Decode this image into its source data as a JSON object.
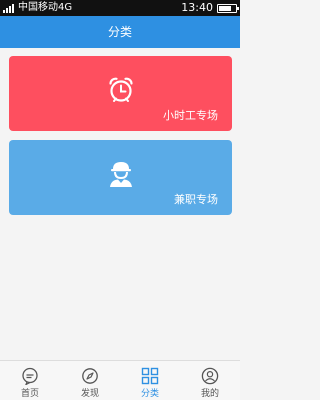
{
  "status_bar": {
    "carrier": "中国移动4G",
    "time": "13:40",
    "battery_level": 0.75
  },
  "header": {
    "title": "分类"
  },
  "cards": [
    {
      "label": "小时工专场",
      "icon": "alarm-clock-icon",
      "color": "#fe4f5f"
    },
    {
      "label": "兼职专场",
      "icon": "worker-cap-icon",
      "color": "#5aabe7"
    }
  ],
  "tabs": [
    {
      "label": "首页",
      "icon": "home-chat-icon",
      "active": false
    },
    {
      "label": "发现",
      "icon": "compass-icon",
      "active": false
    },
    {
      "label": "分类",
      "icon": "grid-icon",
      "active": true
    },
    {
      "label": "我的",
      "icon": "user-icon",
      "active": false
    }
  ],
  "colors": {
    "accent": "#2e90e2",
    "inactive": "#555555"
  }
}
